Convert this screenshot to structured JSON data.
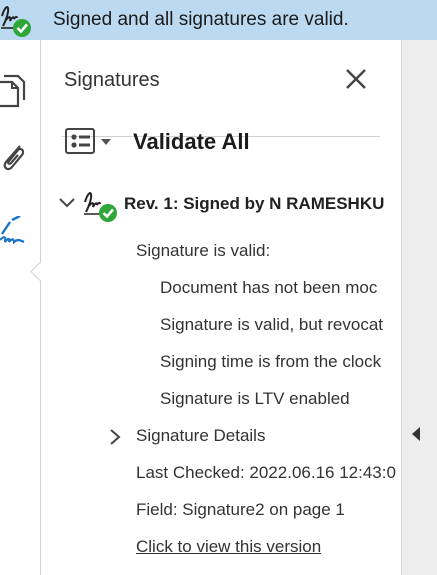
{
  "banner": {
    "icon": "signature-valid-icon",
    "text": "Signed and all signatures are valid."
  },
  "rail": {
    "items": [
      {
        "icon": "pages-icon"
      },
      {
        "icon": "attachment-icon"
      },
      {
        "icon": "signature-pen-icon",
        "active": true
      }
    ]
  },
  "panel": {
    "title": "Signatures",
    "validate_all": "Validate All",
    "revision": {
      "label": "Rev. 1: Signed by N RAMESHKU",
      "status_heading": "Signature is valid:",
      "details": [
        "Document has not been moc",
        "Signature is valid, but revocat",
        "Signing time is from the clock",
        "Signature is LTV enabled"
      ],
      "signature_details": "Signature Details",
      "last_checked": "Last Checked: 2022.06.16 12:43:0",
      "field": "Field: Signature2 on page 1",
      "view_version_link": "Click to view this version"
    }
  },
  "colors": {
    "banner_bg": "#bcd9f2",
    "accent_blue": "#1a73c9",
    "valid_green": "#2fa63a"
  }
}
